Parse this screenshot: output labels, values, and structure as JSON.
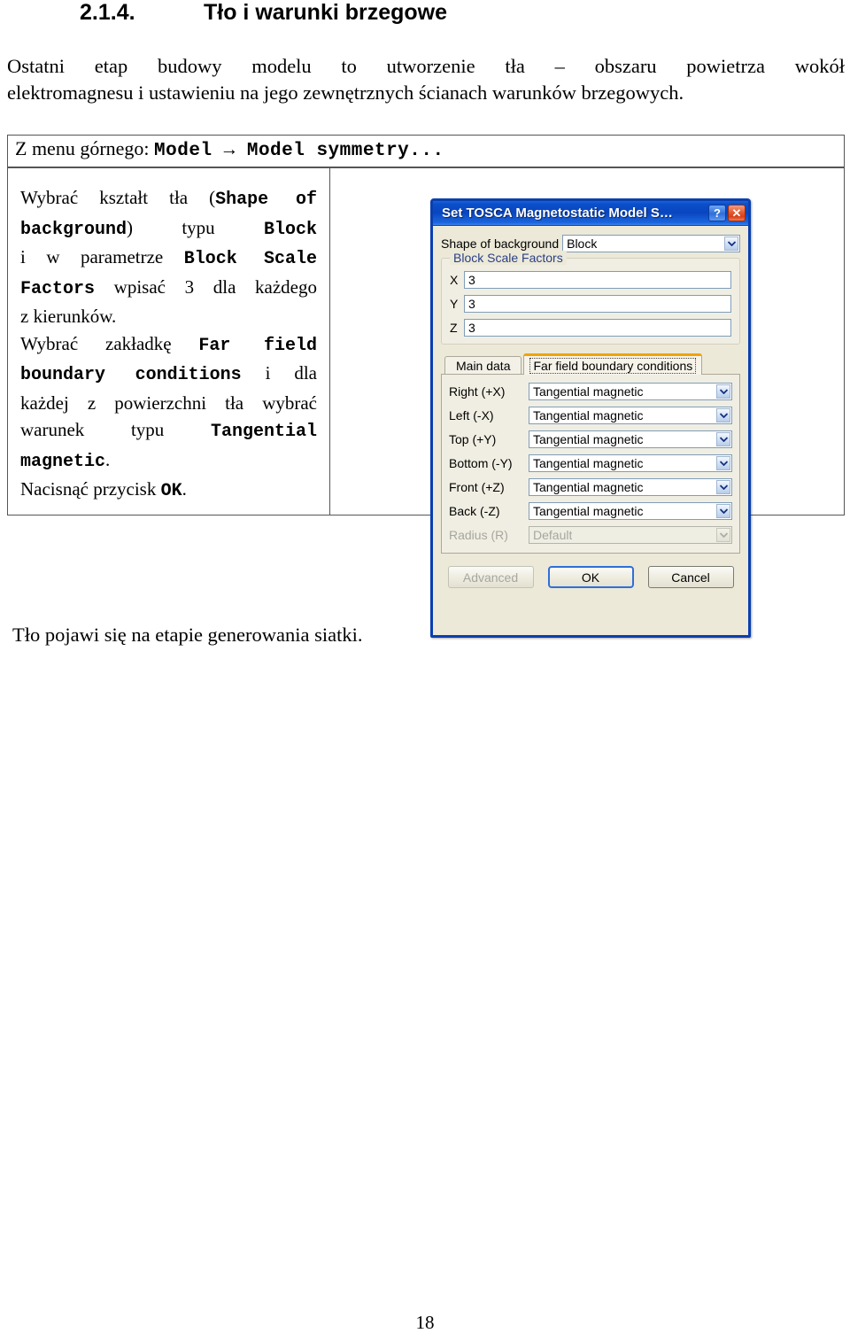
{
  "document": {
    "section_number": "2.1.4.",
    "section_title": "Tło i warunki brzegowe",
    "intro_line1": "Ostatni   etap   budowy   modelu   to   utworzenie   tła – obszaru   powietrza   wokół",
    "intro_line2": "elektromagnesu i ustawieniu na jego zewnętrznych ścianach warunków brzegowych.",
    "after_table": "Tło pojawi się na etapie generowania siatki.",
    "page_number": "18"
  },
  "table": {
    "menu_row": {
      "prefix": "Z menu górnego: ",
      "command": "Model → Model symmetry..."
    },
    "instructions": {
      "l1_a": "Wybrać kształt tła (",
      "l1_b": "Shape of",
      "l2_a": "background",
      "l2_b": ") typu ",
      "l2_c": "Block",
      "l3_a": " i w parametrze ",
      "l3_b": "Block Scale",
      "l4_a": "Factors",
      "l4_b": " wpisać 3 dla każdego",
      "l5": "z kierunków.",
      "l6_a": "Wybrać zakładkę ",
      "l6_b": "Far field",
      "l7_a": "boundary conditions",
      "l7_b": " i dla",
      "l8": "każdej z powierzchni tła wybrać",
      "l9_a": "warunek typu ",
      "l9_b": "Tangential",
      "l10_a": "magnetic",
      "l10_b": ".",
      "l11_a": "Nacisnąć przycisk ",
      "l11_b": "OK",
      "l11_c": "."
    }
  },
  "dialog": {
    "title": "Set TOSCA Magnetostatic Model S…",
    "help_button": "?",
    "close_button": "✕",
    "shape_label": "Shape of background",
    "shape_value": "Block",
    "group_title": "Block Scale Factors",
    "scale_factors": [
      {
        "axis": "X",
        "value": "3"
      },
      {
        "axis": "Y",
        "value": "3"
      },
      {
        "axis": "Z",
        "value": "3"
      }
    ],
    "tabs": [
      {
        "label": "Main data",
        "active": false
      },
      {
        "label": "Far field boundary conditions",
        "active": true
      }
    ],
    "boundary_conditions": [
      {
        "label": "Right (+X)",
        "value": "Tangential magnetic",
        "disabled": false
      },
      {
        "label": "Left (-X)",
        "value": "Tangential magnetic",
        "disabled": false
      },
      {
        "label": "Top (+Y)",
        "value": "Tangential magnetic",
        "disabled": false
      },
      {
        "label": "Bottom (-Y)",
        "value": "Tangential magnetic",
        "disabled": false
      },
      {
        "label": "Front (+Z)",
        "value": "Tangential magnetic",
        "disabled": false
      },
      {
        "label": "Back (-Z)",
        "value": "Tangential magnetic",
        "disabled": false
      },
      {
        "label": "Radius (R)",
        "value": "Default",
        "disabled": true
      }
    ],
    "buttons": {
      "advanced": "Advanced",
      "ok": "OK",
      "cancel": "Cancel"
    },
    "colors": {
      "titlebar": "#0a45c0",
      "dialog_face": "#ece9d8",
      "active_tab_accent": "#f0a30a",
      "group_label": "#2a3f85",
      "close_button": "#d8411c"
    }
  }
}
